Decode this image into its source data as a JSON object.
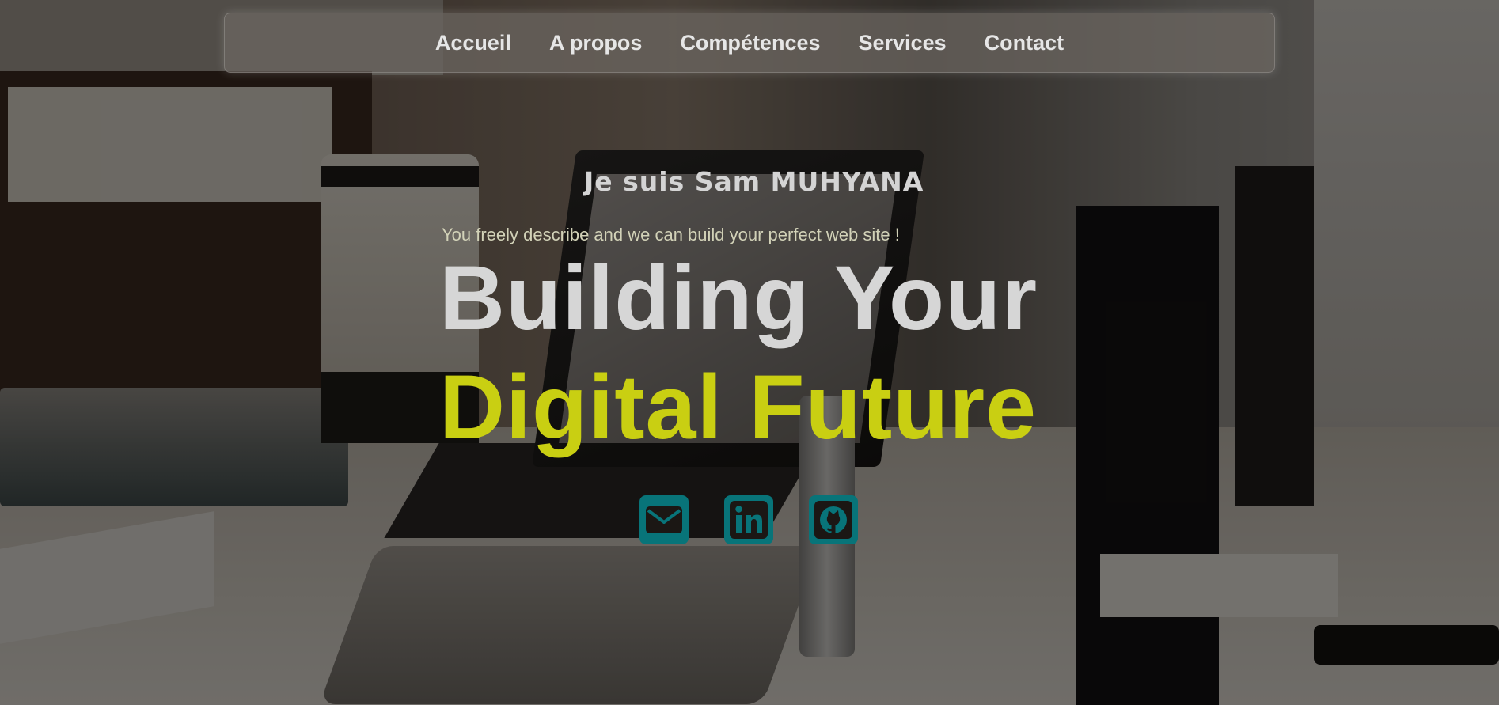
{
  "nav": {
    "items": [
      {
        "label": "Accueil"
      },
      {
        "label": "A propos"
      },
      {
        "label": "Compétences"
      },
      {
        "label": "Services"
      },
      {
        "label": "Contact"
      }
    ]
  },
  "hero": {
    "intro": "Je suis Sam MUHYANA",
    "tagline": "You freely describe and we can build your perfect web site !",
    "title_line1": "Building Your",
    "title_line2": "Digital Future"
  },
  "socials": [
    {
      "icon": "envelope-icon"
    },
    {
      "icon": "linkedin-icon"
    },
    {
      "icon": "github-icon"
    }
  ],
  "colors": {
    "accent_yellow": "#c9cf12",
    "social_teal": "#087479",
    "nav_text": "#e6e6e6"
  }
}
